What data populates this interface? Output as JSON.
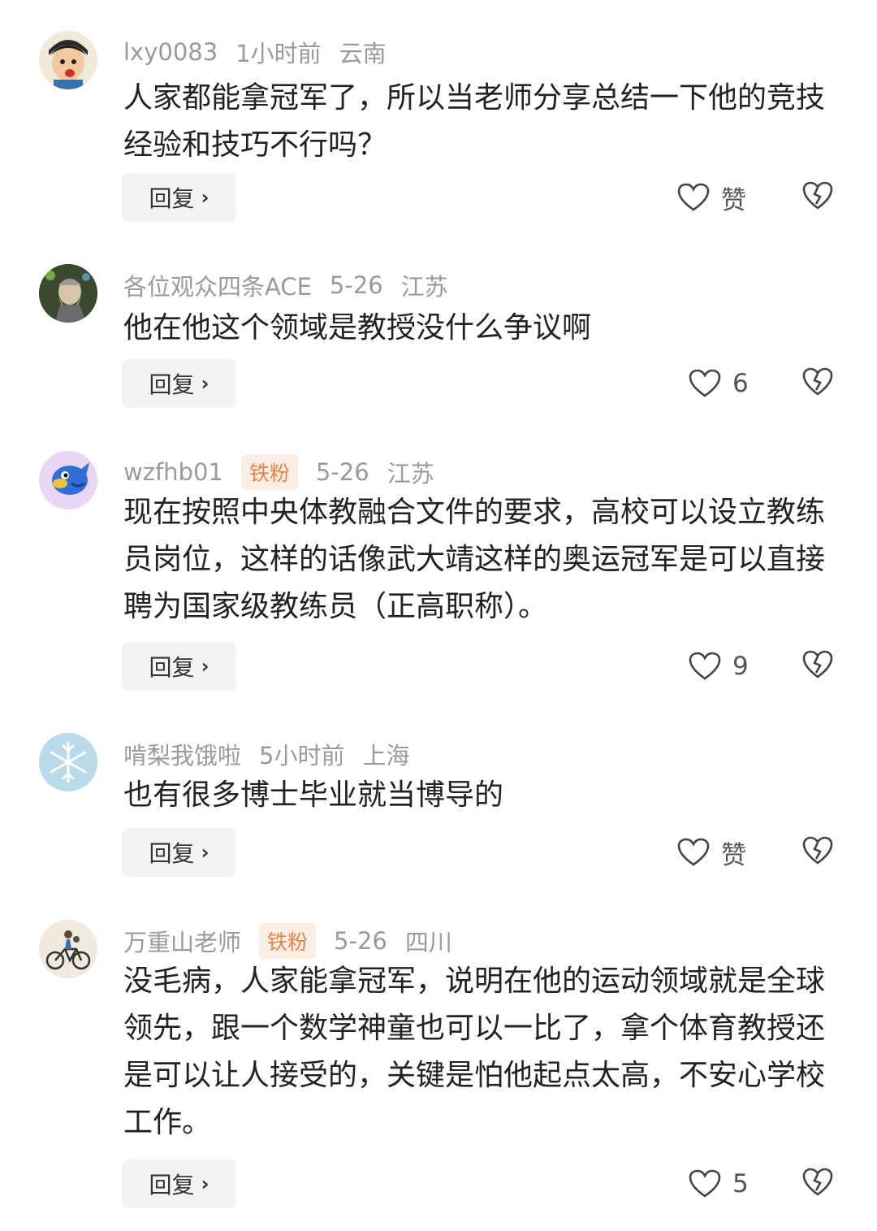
{
  "comments": [
    {
      "user": "lxy0083",
      "badge": "",
      "time": "1小时前",
      "location": "云南",
      "text": "人家都能拿冠军了，所以当老师分享总结一下他的竞技经验和技巧不行吗？",
      "reply_label": "回复",
      "like_label": "赞",
      "avatar_icon": "cartoon-boy-avatar"
    },
    {
      "user": "各位观众四条ACE",
      "badge": "",
      "time": "5-26",
      "location": "江苏",
      "text": "他在他这个领域是教授没什么争议啊",
      "reply_label": "回复",
      "like_label": "6",
      "avatar_icon": "wizard-avatar"
    },
    {
      "user": "wzfhb01",
      "badge": "铁粉",
      "time": "5-26",
      "location": "江苏",
      "text": "现在按照中央体教融合文件的要求，高校可以设立教练员岗位，这样的话像武大靖这样的奥运冠军是可以直接聘为国家级教练员（正高职称）。",
      "reply_label": "回复",
      "like_label": "9",
      "avatar_icon": "blue-bird-avatar"
    },
    {
      "user": "啃梨我饿啦",
      "badge": "",
      "time": "5小时前",
      "location": "上海",
      "text": "也有很多博士毕业就当博导的",
      "reply_label": "回复",
      "like_label": "赞",
      "avatar_icon": "snowflake-avatar"
    },
    {
      "user": "万重山老师",
      "badge": "铁粉",
      "time": "5-26",
      "location": "四川",
      "text": "没毛病，人家能拿冠军，说明在他的运动领域就是全球领先，跟一个数学神童也可以一比了，拿个体育教授还是可以让人接受的，关键是怕他起点太高，不安心学校工作。",
      "reply_label": "回复",
      "like_label": "5",
      "avatar_icon": "bicycle-avatar"
    }
  ],
  "colors": {
    "badge_bg": "#fdeee4",
    "badge_text": "#e8834a",
    "meta": "#9a9a9a"
  }
}
